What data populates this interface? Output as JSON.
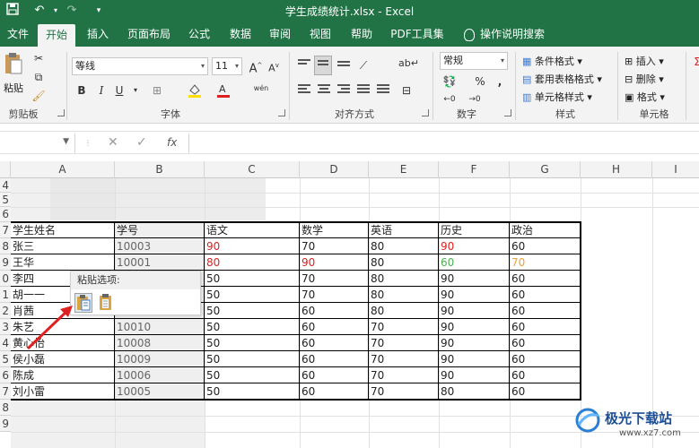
{
  "titlebar": {
    "title": "学生成绩统计.xlsx - Excel"
  },
  "tabs": [
    "文件",
    "开始",
    "插入",
    "页面布局",
    "公式",
    "数据",
    "审阅",
    "视图",
    "帮助",
    "PDF工具集",
    "操作说明搜索"
  ],
  "ribbon": {
    "clipboard": {
      "paste": "粘贴",
      "label": "剪贴板"
    },
    "font": {
      "name": "等线",
      "size": "11",
      "grow": "A",
      "shrink": "A",
      "bold": "B",
      "italic": "I",
      "underline": "U",
      "wen": "wén",
      "label": "字体"
    },
    "align": {
      "label": "对齐方式"
    },
    "number": {
      "format": "常规",
      "percent": "%",
      "comma": ",",
      "label": "数字"
    },
    "styles": {
      "conditional": "条件格式",
      "table": "套用表格格式",
      "cell": "单元格样式",
      "label": "样式"
    },
    "cells": {
      "insert": "插入",
      "delete": "删除",
      "format": "格式",
      "label": "单元格"
    }
  },
  "formula_bar": {
    "cancel": "✕",
    "enter": "✓",
    "fx": "fx"
  },
  "columns": [
    "A",
    "B",
    "C",
    "D",
    "E",
    "F",
    "G",
    "H",
    "I"
  ],
  "rows": [
    "4",
    "5",
    "6",
    "7",
    "8",
    "9",
    "0",
    "1",
    "2",
    "3",
    "4",
    "5",
    "6",
    "7",
    "8",
    "9"
  ],
  "table": {
    "header": [
      "学生姓名",
      "学号",
      "语文",
      "数学",
      "英语",
      "历史",
      "政治"
    ],
    "rows": [
      [
        "张三",
        "10003",
        "90",
        "70",
        "80",
        "90",
        "60"
      ],
      [
        "王华",
        "10001",
        "80",
        "90",
        "80",
        "60",
        "70"
      ],
      [
        "李四",
        "",
        "50",
        "70",
        "80",
        "90",
        "60"
      ],
      [
        "胡一一",
        "",
        "50",
        "70",
        "80",
        "90",
        "60"
      ],
      [
        "肖茜",
        "",
        "50",
        "60",
        "80",
        "90",
        "60"
      ],
      [
        "朱艺",
        "10010",
        "50",
        "60",
        "70",
        "90",
        "60"
      ],
      [
        "黄心怡",
        "10008",
        "50",
        "60",
        "70",
        "90",
        "60"
      ],
      [
        "侯小磊",
        "10009",
        "50",
        "60",
        "70",
        "90",
        "60"
      ],
      [
        "陈成",
        "10006",
        "50",
        "60",
        "70",
        "90",
        "60"
      ],
      [
        "刘小雷",
        "10005",
        "50",
        "60",
        "70",
        "80",
        "60"
      ]
    ],
    "colors": {
      "red": "#e02020",
      "green": "#4caf50",
      "orange": "#f0a030",
      "gray": "#666666"
    }
  },
  "paste_popup": {
    "title": "粘贴选项:"
  },
  "watermark": {
    "name": "极光下载站",
    "url": "www.xz7.com"
  }
}
